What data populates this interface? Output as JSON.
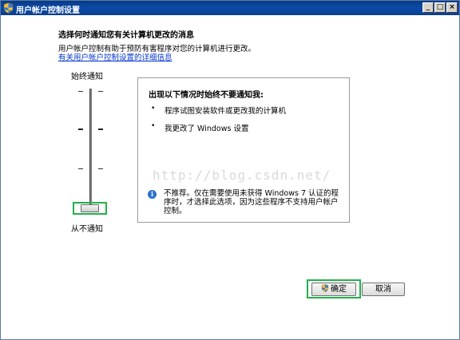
{
  "window": {
    "title": "用户帐户控制设置",
    "minimize_glyph": "_",
    "maximize_glyph": "□",
    "close_glyph": "×"
  },
  "header": {
    "heading": "选择何时通知您有关计算机更改的消息",
    "description": "用户帐户控制有助于预防有害程序对您的计算机进行更改。",
    "link": "有关用户帐户控制设置的详细信息"
  },
  "slider": {
    "top_label": "始终通知",
    "bottom_label": "从不通知",
    "levels": 4,
    "selected_level": 1
  },
  "panel": {
    "title": "出现以下情况时始终不要通知我:",
    "bullets": [
      "程序试图安装软件或更改我的计算机",
      "我更改了 Windows 设置"
    ],
    "bullet_glyph": "•",
    "info_glyph": "i",
    "note": "不推荐。仅在需要使用未获得 Windows 7 认证的程序时，才选择此选项，因为这些程序不支持用户帐户控制。"
  },
  "watermark": "http://blog.csdn.net/",
  "buttons": {
    "ok": "确定",
    "cancel": "取消"
  },
  "colors": {
    "titlebar": "#0b4aa8",
    "highlight": "#22b14c",
    "link": "#0033cc",
    "info_icon": "#2a6fd0"
  }
}
